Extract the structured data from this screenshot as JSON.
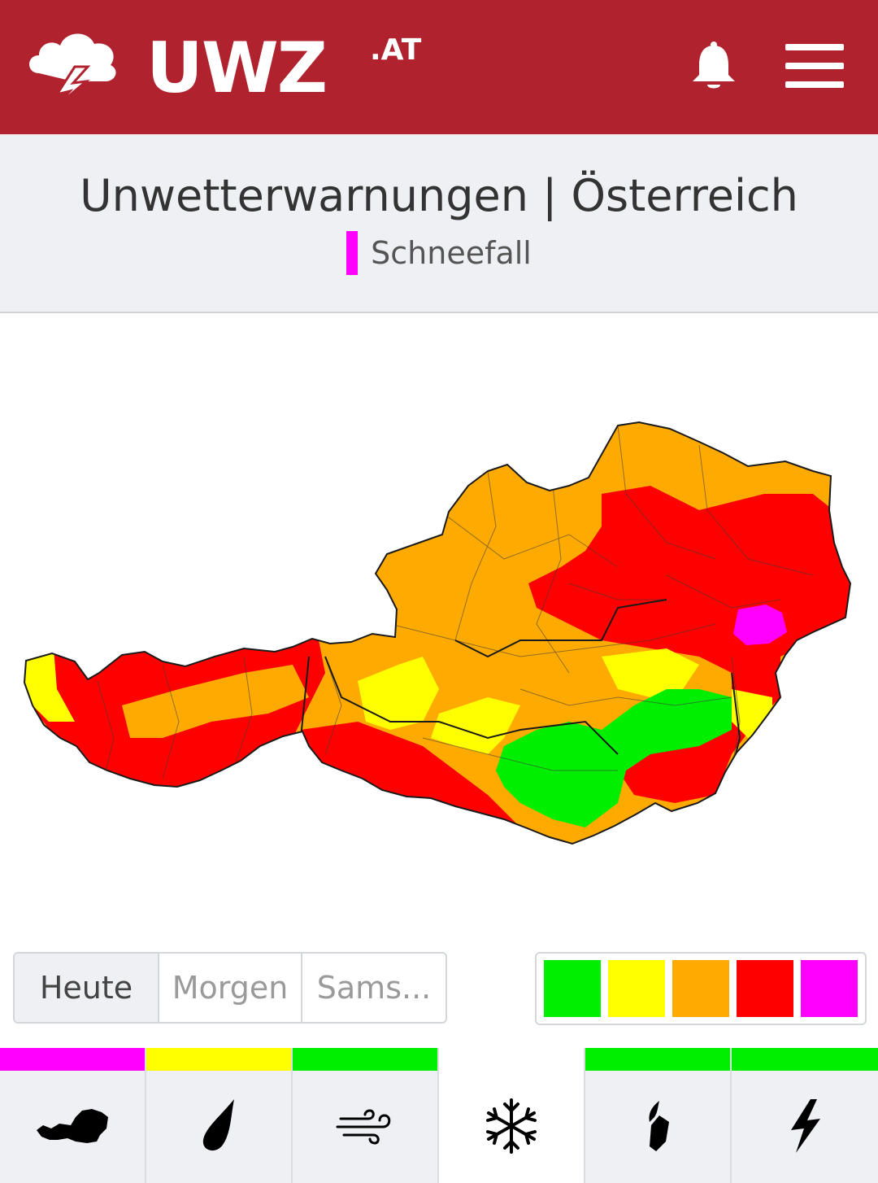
{
  "header": {
    "logo_text": "UWZ",
    "logo_suffix": ".AT",
    "logo_icon": "storm-cloud-lightning-icon",
    "notifications_icon": "bell-icon",
    "menu_icon": "hamburger-menu-icon",
    "background_color": "#b0222e"
  },
  "title_panel": {
    "title": "Unwetterwarnungen | Österreich",
    "subtitle": "Schneefall",
    "subtitle_color": "#ff00ff"
  },
  "map": {
    "region": "Österreich",
    "colors": {
      "green": "#00ee00",
      "yellow": "#ffff00",
      "orange": "#ffaa00",
      "red": "#ff0000",
      "violet": "#ff00ff"
    }
  },
  "day_tabs": [
    {
      "label": "Heute",
      "active": true
    },
    {
      "label": "Morgen",
      "active": false
    },
    {
      "label": "Sams...",
      "active": false
    }
  ],
  "legend": [
    {
      "color": "#00ee00"
    },
    {
      "color": "#ffff00"
    },
    {
      "color": "#ffaa00"
    },
    {
      "color": "#ff0000"
    },
    {
      "color": "#ff00ff"
    }
  ],
  "bottom_nav": [
    {
      "icon": "austria-map-icon",
      "level_color": "#ff00ff",
      "active": false
    },
    {
      "icon": "rain-drop-icon",
      "level_color": "#ffff00",
      "active": false
    },
    {
      "icon": "wind-icon",
      "level_color": "#00ee00",
      "active": false
    },
    {
      "icon": "snowflake-icon",
      "level_color": "",
      "active": true
    },
    {
      "icon": "black-ice-icon",
      "level_color": "#00ee00",
      "active": false
    },
    {
      "icon": "lightning-icon",
      "level_color": "#00ee00",
      "active": false
    }
  ]
}
